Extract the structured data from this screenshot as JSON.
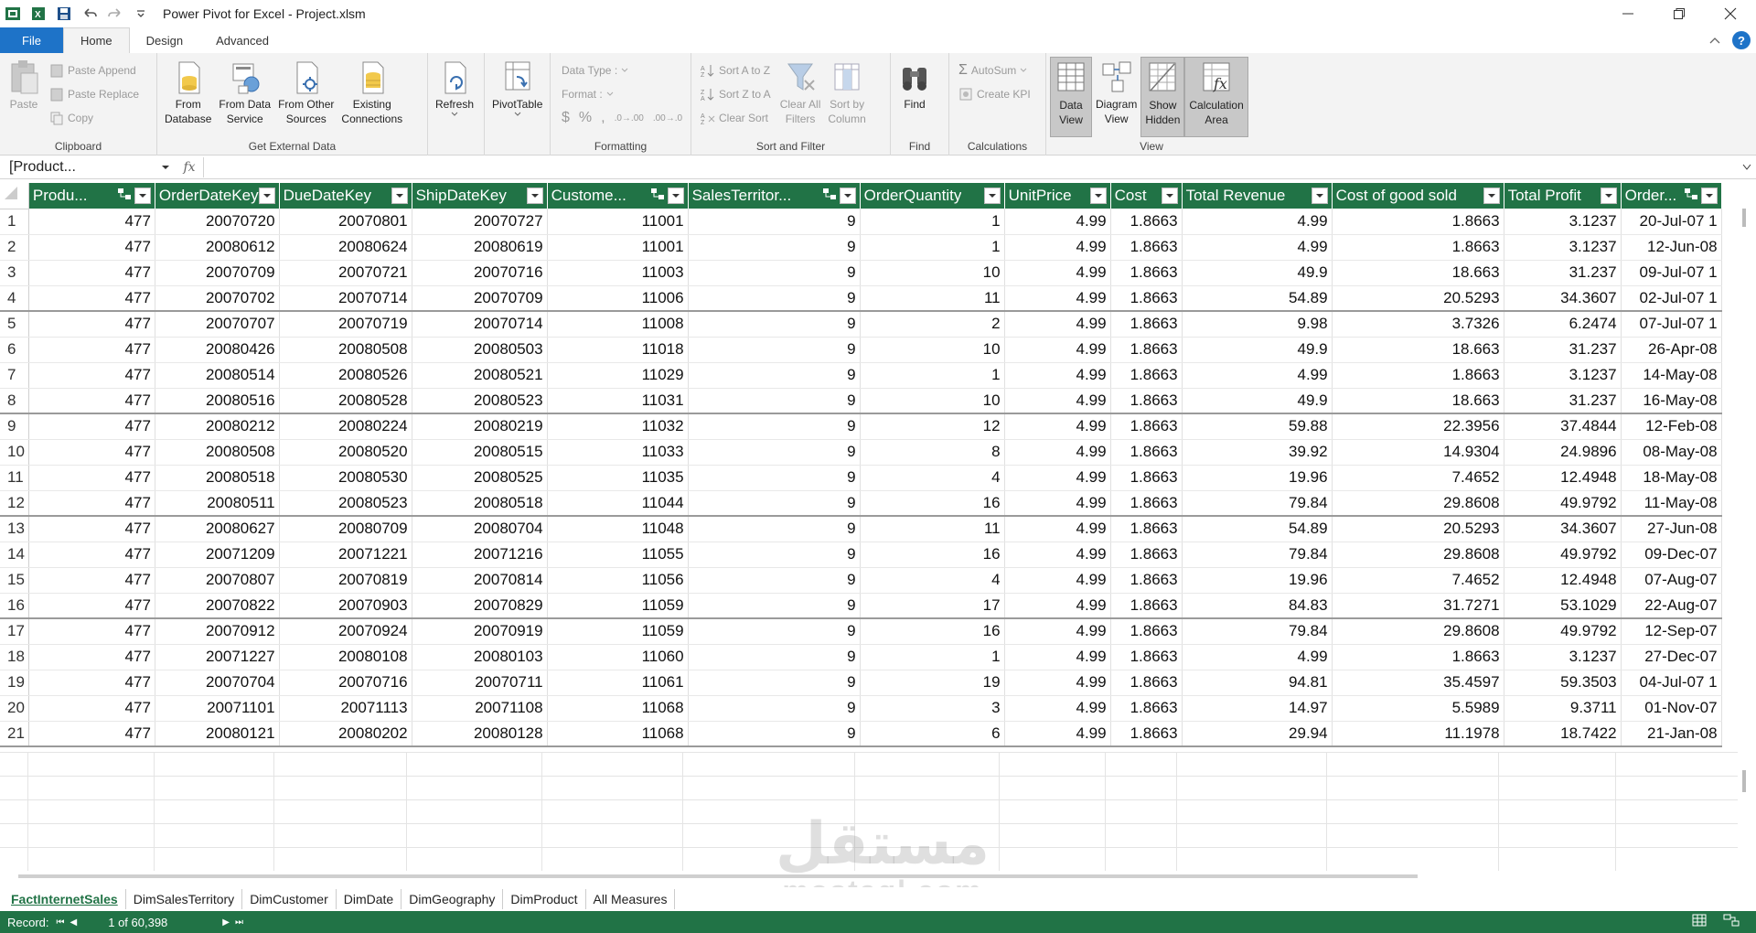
{
  "window": {
    "title": "Power Pivot for Excel - Project.xlsm"
  },
  "ribbon_tabs": [
    "File",
    "Home",
    "Design",
    "Advanced"
  ],
  "ribbon": {
    "clipboard": {
      "label": "Clipboard",
      "paste": "Paste",
      "paste_append": "Paste Append",
      "paste_replace": "Paste Replace",
      "copy": "Copy"
    },
    "external": {
      "label": "Get External Data",
      "from_database_1": "From",
      "from_database_2": "Database",
      "from_data_service_1": "From Data",
      "from_data_service_2": "Service",
      "from_other_1": "From Other",
      "from_other_2": "Sources",
      "existing_1": "Existing",
      "existing_2": "Connections"
    },
    "refresh": "Refresh",
    "pivottable": "PivotTable",
    "formatting": {
      "label": "Formatting",
      "data_type": "Data Type :",
      "format": "Format :"
    },
    "sort_filter": {
      "label": "Sort and Filter",
      "sort_a_z": "Sort A to Z",
      "sort_z_a": "Sort Z to A",
      "clear_sort": "Clear Sort",
      "clear_all_1": "Clear All",
      "clear_all_2": "Filters",
      "sort_by_1": "Sort by",
      "sort_by_2": "Column"
    },
    "find": {
      "label": "Find",
      "find": "Find"
    },
    "calculations": {
      "label": "Calculations",
      "autosum": "AutoSum",
      "create_kpi": "Create KPI"
    },
    "view": {
      "label": "View",
      "data_view_1": "Data",
      "data_view_2": "View",
      "diagram_view_1": "Diagram",
      "diagram_view_2": "View",
      "show_hidden_1": "Show",
      "show_hidden_2": "Hidden",
      "calc_area_1": "Calculation",
      "calc_area_2": "Area"
    }
  },
  "formula_bar": {
    "name_box": "[Product...",
    "fx": "fx",
    "value": ""
  },
  "table": {
    "columns": [
      "Produ...",
      "OrderDateKey",
      "DueDateKey",
      "ShipDateKey",
      "Custome...",
      "SalesTerritor...",
      "OrderQuantity",
      "UnitPrice",
      "Cost",
      "Total Revenue",
      "Cost of good sold",
      "Total Profit",
      "Order..."
    ],
    "rows": [
      [
        "1",
        "477",
        "20070720",
        "20070801",
        "20070727",
        "11001",
        "9",
        "1",
        "4.99",
        "1.8663",
        "4.99",
        "1.8663",
        "3.1237",
        "20-Jul-07 1"
      ],
      [
        "2",
        "477",
        "20080612",
        "20080624",
        "20080619",
        "11001",
        "9",
        "1",
        "4.99",
        "1.8663",
        "4.99",
        "1.8663",
        "3.1237",
        "12-Jun-08"
      ],
      [
        "3",
        "477",
        "20070709",
        "20070721",
        "20070716",
        "11003",
        "9",
        "10",
        "4.99",
        "1.8663",
        "49.9",
        "18.663",
        "31.237",
        "09-Jul-07 1"
      ],
      [
        "4",
        "477",
        "20070702",
        "20070714",
        "20070709",
        "11006",
        "9",
        "11",
        "4.99",
        "1.8663",
        "54.89",
        "20.5293",
        "34.3607",
        "02-Jul-07 1"
      ],
      [
        "5",
        "477",
        "20070707",
        "20070719",
        "20070714",
        "11008",
        "9",
        "2",
        "4.99",
        "1.8663",
        "9.98",
        "3.7326",
        "6.2474",
        "07-Jul-07 1"
      ],
      [
        "6",
        "477",
        "20080426",
        "20080508",
        "20080503",
        "11018",
        "9",
        "10",
        "4.99",
        "1.8663",
        "49.9",
        "18.663",
        "31.237",
        "26-Apr-08"
      ],
      [
        "7",
        "477",
        "20080514",
        "20080526",
        "20080521",
        "11029",
        "9",
        "1",
        "4.99",
        "1.8663",
        "4.99",
        "1.8663",
        "3.1237",
        "14-May-08"
      ],
      [
        "8",
        "477",
        "20080516",
        "20080528",
        "20080523",
        "11031",
        "9",
        "10",
        "4.99",
        "1.8663",
        "49.9",
        "18.663",
        "31.237",
        "16-May-08"
      ],
      [
        "9",
        "477",
        "20080212",
        "20080224",
        "20080219",
        "11032",
        "9",
        "12",
        "4.99",
        "1.8663",
        "59.88",
        "22.3956",
        "37.4844",
        "12-Feb-08"
      ],
      [
        "10",
        "477",
        "20080508",
        "20080520",
        "20080515",
        "11033",
        "9",
        "8",
        "4.99",
        "1.8663",
        "39.92",
        "14.9304",
        "24.9896",
        "08-May-08"
      ],
      [
        "11",
        "477",
        "20080518",
        "20080530",
        "20080525",
        "11035",
        "9",
        "4",
        "4.99",
        "1.8663",
        "19.96",
        "7.4652",
        "12.4948",
        "18-May-08"
      ],
      [
        "12",
        "477",
        "20080511",
        "20080523",
        "20080518",
        "11044",
        "9",
        "16",
        "4.99",
        "1.8663",
        "79.84",
        "29.8608",
        "49.9792",
        "11-May-08"
      ],
      [
        "13",
        "477",
        "20080627",
        "20080709",
        "20080704",
        "11048",
        "9",
        "11",
        "4.99",
        "1.8663",
        "54.89",
        "20.5293",
        "34.3607",
        "27-Jun-08"
      ],
      [
        "14",
        "477",
        "20071209",
        "20071221",
        "20071216",
        "11055",
        "9",
        "16",
        "4.99",
        "1.8663",
        "79.84",
        "29.8608",
        "49.9792",
        "09-Dec-07"
      ],
      [
        "15",
        "477",
        "20070807",
        "20070819",
        "20070814",
        "11056",
        "9",
        "4",
        "4.99",
        "1.8663",
        "19.96",
        "7.4652",
        "12.4948",
        "07-Aug-07"
      ],
      [
        "16",
        "477",
        "20070822",
        "20070903",
        "20070829",
        "11059",
        "9",
        "17",
        "4.99",
        "1.8663",
        "84.83",
        "31.7271",
        "53.1029",
        "22-Aug-07"
      ],
      [
        "17",
        "477",
        "20070912",
        "20070924",
        "20070919",
        "11059",
        "9",
        "16",
        "4.99",
        "1.8663",
        "79.84",
        "29.8608",
        "49.9792",
        "12-Sep-07"
      ],
      [
        "18",
        "477",
        "20071227",
        "20080108",
        "20080103",
        "11060",
        "9",
        "1",
        "4.99",
        "1.8663",
        "4.99",
        "1.8663",
        "3.1237",
        "27-Dec-07"
      ],
      [
        "19",
        "477",
        "20070704",
        "20070716",
        "20070711",
        "11061",
        "9",
        "19",
        "4.99",
        "1.8663",
        "94.81",
        "35.4597",
        "59.3503",
        "04-Jul-07 1"
      ],
      [
        "20",
        "477",
        "20071101",
        "20071113",
        "20071108",
        "11068",
        "9",
        "3",
        "4.99",
        "1.8663",
        "14.97",
        "5.5989",
        "9.3711",
        "01-Nov-07"
      ],
      [
        "21",
        "477",
        "20080121",
        "20080202",
        "20080128",
        "11068",
        "9",
        "6",
        "4.99",
        "1.8663",
        "29.94",
        "11.1978",
        "18.7422",
        "21-Jan-08"
      ]
    ]
  },
  "sheet_tabs": [
    "FactInternetSales",
    "DimSalesTerritory",
    "DimCustomer",
    "DimDate",
    "DimGeography",
    "DimProduct",
    "All Measures"
  ],
  "status": {
    "record_label": "Record:",
    "record_value": "1 of 60,398"
  },
  "watermark": {
    "arabic": "مستقل",
    "latin": "mostaql.com"
  },
  "colors": {
    "accent_green": "#217346",
    "file_blue": "#1e73c8"
  }
}
